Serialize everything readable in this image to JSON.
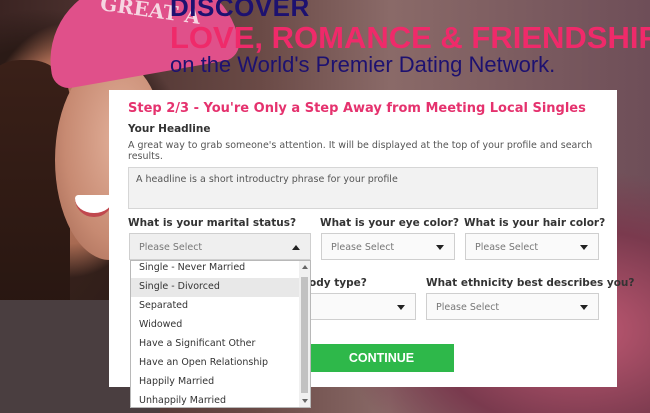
{
  "hero": {
    "cap_text": "GREAT A",
    "discover": "DISCOVER",
    "love": "LOVE, ROMANCE & FRIENDSHIP",
    "network": "on the World's Premier Dating Network."
  },
  "form": {
    "step_title": "Step 2/3 - You're Only a Step Away from Meeting Local Singles",
    "headline_label": "Your Headline",
    "headline_hint": "A great way to grab someone's attention. It will be displayed at the top of your profile and search results.",
    "headline_placeholder": "A headline is a short introductry phrase for your profile",
    "marital": {
      "label": "What is your marital status?",
      "value": "Please Select"
    },
    "eye": {
      "label": "What is your eye color?",
      "value": "Please Select"
    },
    "hair": {
      "label": "What is your hair color?",
      "value": "Please Select"
    },
    "body": {
      "label": "ody type?",
      "value": ""
    },
    "ethnicity": {
      "label": "What ethnicity best describes you?",
      "value": "Please Select"
    },
    "continue_label": "CONTINUE"
  },
  "dropdown": {
    "options": [
      "Single - Never Married",
      "Single - Divorced",
      "Separated",
      "Widowed",
      "Have a Significant Other",
      "Have an Open Relationship",
      "Happily Married",
      "Unhappily Married"
    ],
    "highlighted": "Single - Divorced"
  }
}
